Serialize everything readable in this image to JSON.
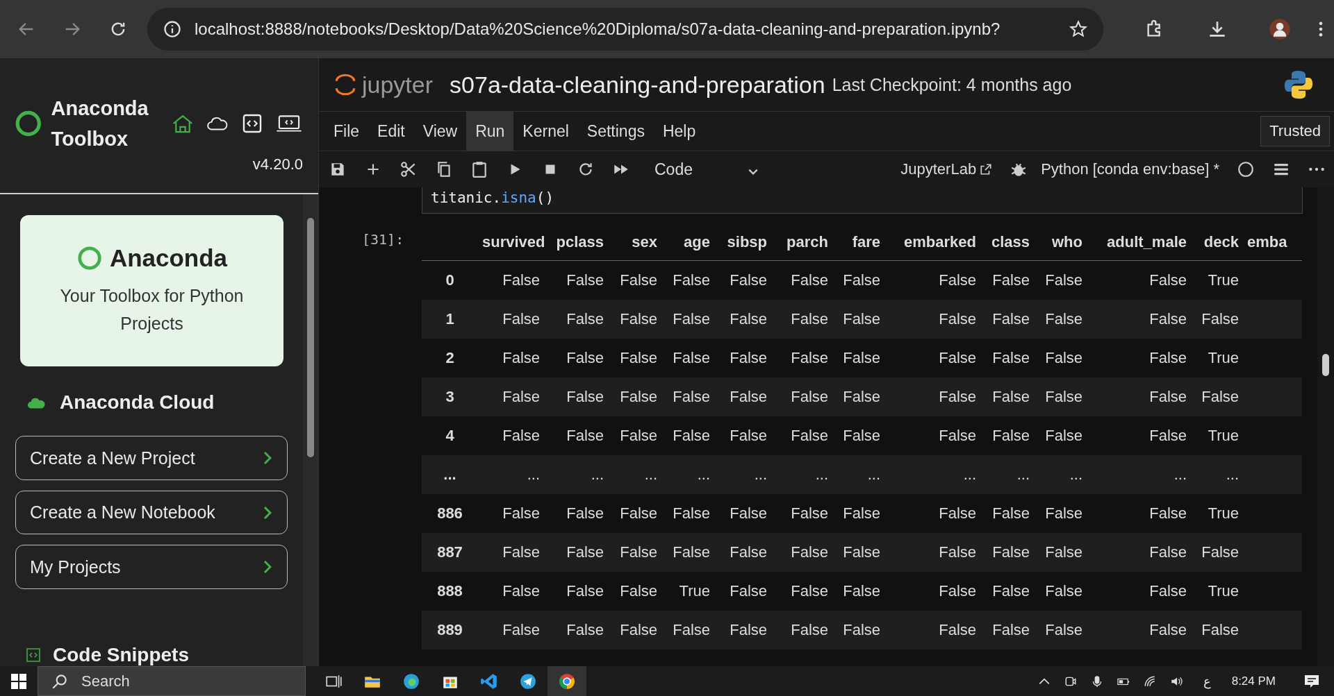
{
  "browser": {
    "url": "localhost:8888/notebooks/Desktop/Data%20Science%20Diploma/s07a-data-cleaning-and-preparation.ipynb?"
  },
  "sidebar": {
    "title": "Anaconda Toolbox",
    "version": "v4.20.0",
    "card": {
      "title": "Anaconda",
      "subtitle": "Your Toolbox for Python Projects"
    },
    "cloud_heading": "Anaconda Cloud",
    "actions": [
      "Create a New Project",
      "Create a New Notebook",
      "My Projects"
    ],
    "snippets_heading": "Code Snippets"
  },
  "notebook": {
    "logo_text": "jupyter",
    "title": "s07a-data-cleaning-and-preparation",
    "checkpoint": "Last Checkpoint: 4 months ago",
    "menu": [
      {
        "label": "File",
        "selected": false
      },
      {
        "label": "Edit",
        "selected": false
      },
      {
        "label": "View",
        "selected": false
      },
      {
        "label": "Run",
        "selected": true
      },
      {
        "label": "Kernel",
        "selected": false
      },
      {
        "label": "Settings",
        "selected": false
      },
      {
        "label": "Help",
        "selected": false
      }
    ],
    "trusted": "Trusted",
    "cell_type": "Code",
    "jupyterlab": "JupyterLab",
    "kernel": "Python [conda env:base] *",
    "code": [
      {
        "text": "titanic.",
        "kind": "name"
      },
      {
        "text": "isna",
        "kind": "func"
      },
      {
        "text": "()",
        "kind": "punct"
      }
    ],
    "prompt": "[31]:",
    "table": {
      "columns": [
        "survived",
        "pclass",
        "sex",
        "age",
        "sibsp",
        "parch",
        "fare",
        "embarked",
        "class",
        "who",
        "adult_male",
        "deck",
        "emba"
      ],
      "rows": [
        {
          "index": "0",
          "cells": [
            "False",
            "False",
            "False",
            "False",
            "False",
            "False",
            "False",
            "False",
            "False",
            "False",
            "False",
            "True"
          ]
        },
        {
          "index": "1",
          "cells": [
            "False",
            "False",
            "False",
            "False",
            "False",
            "False",
            "False",
            "False",
            "False",
            "False",
            "False",
            "False"
          ]
        },
        {
          "index": "2",
          "cells": [
            "False",
            "False",
            "False",
            "False",
            "False",
            "False",
            "False",
            "False",
            "False",
            "False",
            "False",
            "True"
          ]
        },
        {
          "index": "3",
          "cells": [
            "False",
            "False",
            "False",
            "False",
            "False",
            "False",
            "False",
            "False",
            "False",
            "False",
            "False",
            "False"
          ]
        },
        {
          "index": "4",
          "cells": [
            "False",
            "False",
            "False",
            "False",
            "False",
            "False",
            "False",
            "False",
            "False",
            "False",
            "False",
            "True"
          ]
        },
        {
          "index": "...",
          "cells": [
            "...",
            "...",
            "...",
            "...",
            "...",
            "...",
            "...",
            "...",
            "...",
            "...",
            "...",
            "..."
          ]
        },
        {
          "index": "886",
          "cells": [
            "False",
            "False",
            "False",
            "False",
            "False",
            "False",
            "False",
            "False",
            "False",
            "False",
            "False",
            "True"
          ]
        },
        {
          "index": "887",
          "cells": [
            "False",
            "False",
            "False",
            "False",
            "False",
            "False",
            "False",
            "False",
            "False",
            "False",
            "False",
            "False"
          ]
        },
        {
          "index": "888",
          "cells": [
            "False",
            "False",
            "False",
            "True",
            "False",
            "False",
            "False",
            "False",
            "False",
            "False",
            "False",
            "True"
          ]
        },
        {
          "index": "889",
          "cells": [
            "False",
            "False",
            "False",
            "False",
            "False",
            "False",
            "False",
            "False",
            "False",
            "False",
            "False",
            "False"
          ]
        }
      ]
    }
  },
  "taskbar": {
    "search": "Search",
    "language": "ع",
    "time": "8:24 PM"
  }
}
